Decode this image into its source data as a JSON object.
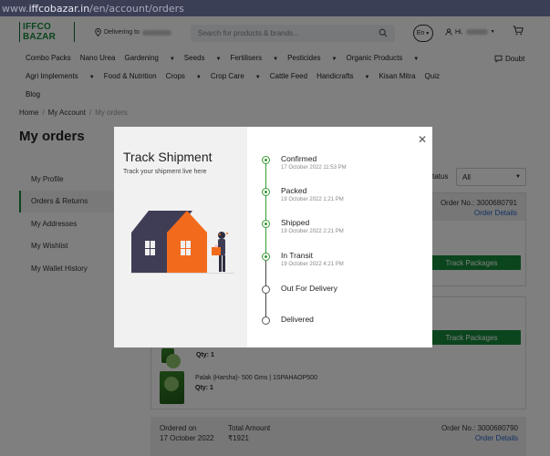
{
  "browser": {
    "url_prefix": "www.",
    "url_host": "iffcobazar.in",
    "url_path": "/en/account/orders"
  },
  "header": {
    "logo_text": "IFFCO BAZAR",
    "delivering_label": "Delivering to",
    "search_placeholder": "Search for products & brands...",
    "lang_label": "En",
    "greeting": "Hi,"
  },
  "nav": {
    "row1": [
      "Combo Packs",
      "Nano Urea",
      "Gardening",
      "Seeds",
      "Fertilisers",
      "Pesticides",
      "Organic Products"
    ],
    "row2": [
      "Agri Implements",
      "Food & Nutrition",
      "Crops",
      "Crop Care",
      "Cattle Feed",
      "Handicrafts",
      "Kisan Mitra",
      "Quiz"
    ],
    "row3": [
      "Blog"
    ],
    "doubt_label": "Doubt"
  },
  "breadcrumb": [
    "Home",
    "My Account",
    "My orders"
  ],
  "page_title": "My orders",
  "sidebar": [
    "My Profile",
    "Orders & Returns",
    "My Addresses",
    "My Wishlist",
    "My Wallet History"
  ],
  "filter": {
    "label": "tatus",
    "value": "All"
  },
  "orders": [
    {
      "order_no_label": "Order No.: 3000680791",
      "details_label": "Order Details",
      "track_label": "Track Packages"
    },
    {
      "track_label": "Track Packages"
    }
  ],
  "products": [
    {
      "name": "Palak (Harsha)- 500 Gms | 1SPAHAOP500",
      "qty": "Qty: 1"
    },
    {
      "qty": "Qty: 1"
    }
  ],
  "last_order": {
    "ordered_label": "Ordered on",
    "ordered_value": "17 October 2022",
    "amount_label": "Total Amount",
    "amount_value": "₹1921",
    "order_no_label": "Order No.: 3000680790",
    "details_label": "Order Details"
  },
  "modal": {
    "title": "Track Shipment",
    "subtitle": "Track your shipment live here",
    "steps": [
      {
        "label": "Confirmed",
        "date": "17 October 2022 11:53 PM",
        "done": true
      },
      {
        "label": "Packed",
        "date": "19 October 2022 1:21 PM",
        "done": true
      },
      {
        "label": "Shipped",
        "date": "19 October 2022 2:21 PM",
        "done": true
      },
      {
        "label": "In Transit",
        "date": "19 October 2022 4:21 PM",
        "done": true
      },
      {
        "label": "Out For Delivery",
        "date": "",
        "done": false
      },
      {
        "label": "Delivered",
        "date": "",
        "done": false
      }
    ]
  },
  "colors": {
    "brand_green": "#178a3c",
    "step_green": "#3a9a36",
    "link_blue": "#2563c9",
    "house_dark": "#3f3d56",
    "house_orange": "#f26b1d"
  }
}
